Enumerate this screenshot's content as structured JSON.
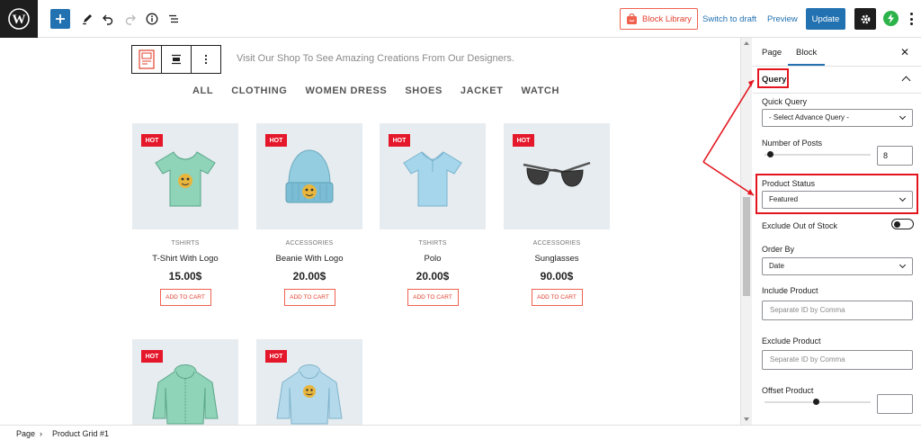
{
  "topbar": {
    "block_library": "Block Library",
    "switch_to_draft": "Switch to draft",
    "preview": "Preview",
    "update": "Update",
    "icons": [
      "wordpress-logo",
      "plus-icon",
      "pencil-icon",
      "undo-icon",
      "redo-icon",
      "info-icon",
      "list-view-icon",
      "gear-icon",
      "bolt-icon",
      "more-vertical-icon"
    ]
  },
  "canvas": {
    "visit_text": "Visit Our Shop To See Amazing Creations From Our Designers.",
    "filters": [
      "ALL",
      "CLOTHING",
      "WOMEN DRESS",
      "SHOES",
      "JACKET",
      "WATCH"
    ],
    "badge": "HOT",
    "add_to_cart": "ADD TO CART",
    "products": [
      {
        "category": "TSHIRTS",
        "name": "T-Shirt With Logo",
        "price": "15.00$"
      },
      {
        "category": "ACCESSORIES",
        "name": "Beanie With Logo",
        "price": "20.00$"
      },
      {
        "category": "TSHIRTS",
        "name": "Polo",
        "price": "20.00$"
      },
      {
        "category": "ACCESSORIES",
        "name": "Sunglasses",
        "price": "90.00$"
      }
    ]
  },
  "sidebar": {
    "tabs": [
      "Page",
      "Block"
    ],
    "active_tab": "Block",
    "panel_title": "Query",
    "quick_query_label": "Quick Query",
    "quick_query_value": "- Select Advance Query -",
    "number_of_posts_label": "Number of Posts",
    "number_of_posts_value": "8",
    "product_status_label": "Product Status",
    "product_status_value": "Featured",
    "exclude_out_of_stock_label": "Exclude Out of Stock",
    "exclude_out_of_stock_on": false,
    "order_by_label": "Order By",
    "order_by_value": "Date",
    "include_product_label": "Include Product",
    "include_product_placeholder": "Separate ID by Comma",
    "exclude_product_label": "Exclude Product",
    "exclude_product_placeholder": "Separate ID by Comma",
    "offset_product_label": "Offset Product"
  },
  "footer": {
    "breadcrumb": [
      "Page",
      "Product Grid #1"
    ]
  },
  "colors": {
    "accent": "#2271b1",
    "annotation": "#e3161f",
    "hot_badge": "#e5172a",
    "card_bg": "#e6ecef"
  }
}
